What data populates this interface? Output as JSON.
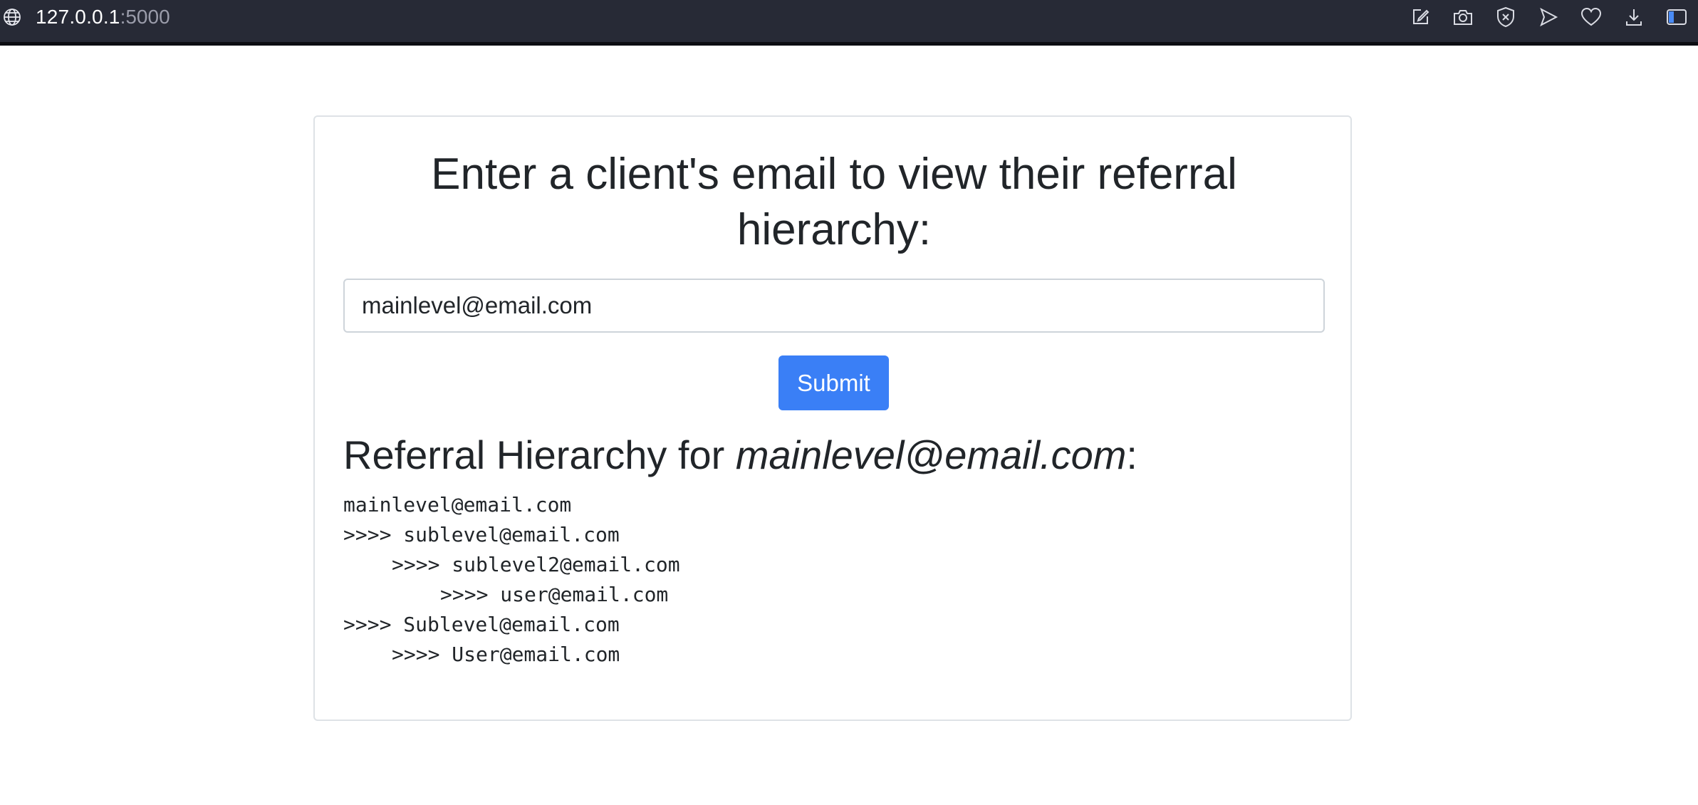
{
  "browser": {
    "url_host": "127.0.0.1",
    "url_port": ":5000",
    "toolbar_icons": [
      "edit-icon",
      "camera-icon",
      "shield-icon",
      "send-icon",
      "heart-icon",
      "download-icon",
      "sidebar-icon"
    ]
  },
  "form": {
    "heading": "Enter a client's email to view their referral hierarchy:",
    "email_value": "mainlevel@email.com",
    "submit_label": "Submit"
  },
  "result": {
    "title_prefix": "Referral Hierarchy for ",
    "title_email": "mainlevel@email.com",
    "title_suffix": ":",
    "lines": [
      {
        "indent": 0,
        "text": "mainlevel@email.com"
      },
      {
        "indent": 0,
        "text": ">>>> sublevel@email.com"
      },
      {
        "indent": 1,
        "text": ">>>> sublevel2@email.com"
      },
      {
        "indent": 2,
        "text": ">>>> user@email.com"
      },
      {
        "indent": 0,
        "text": ">>>> Sublevel@email.com"
      },
      {
        "indent": 1,
        "text": ">>>> User@email.com"
      }
    ]
  },
  "colors": {
    "browser_bar": "#272a36",
    "primary_button": "#3a7ff6",
    "text": "#212529",
    "border": "#dee2e6"
  }
}
